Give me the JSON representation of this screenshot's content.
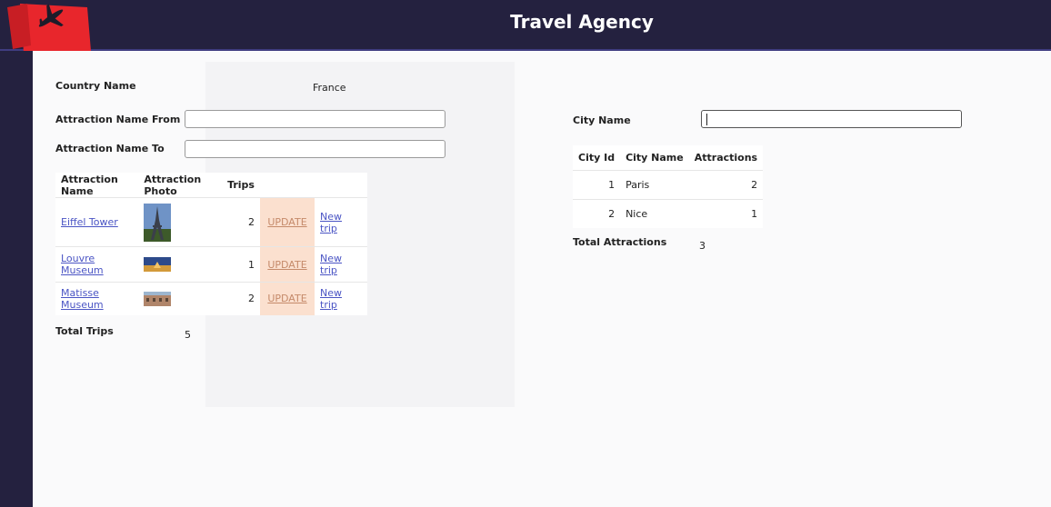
{
  "header": {
    "title": "Travel Agency",
    "logo_icon": "airplane-logo-icon",
    "brand_color": "#e8262c"
  },
  "filters": {
    "country_name_label": "Country Name",
    "country_name_value": "France",
    "attraction_from_label": "Attraction Name From",
    "attraction_from_value": "",
    "attraction_to_label": "Attraction Name To",
    "attraction_to_value": "",
    "city_name_label": "City Name",
    "city_name_value": ""
  },
  "attractions": {
    "columns": [
      "Attraction Name",
      "Attraction Photo",
      "Trips"
    ],
    "rows": [
      {
        "name": "Eiffel Tower",
        "photo": "eiffel-tower-photo",
        "trips": "2",
        "update": "UPDATE",
        "new_trip": "New trip"
      },
      {
        "name": "Louvre Museum",
        "photo": "louvre-museum-photo",
        "trips": "1",
        "update": "UPDATE",
        "new_trip": "New trip"
      },
      {
        "name": "Matisse Museum",
        "photo": "matisse-museum-photo",
        "trips": "2",
        "update": "UPDATE",
        "new_trip": "New trip"
      }
    ],
    "total_label": "Total Trips",
    "total_value": "5"
  },
  "cities": {
    "columns": [
      "City Id",
      "City Name",
      "Attractions"
    ],
    "rows": [
      {
        "id": "1",
        "name": "Paris",
        "attractions": "2"
      },
      {
        "id": "2",
        "name": "Nice",
        "attractions": "1"
      }
    ],
    "total_label": "Total Attractions",
    "total_value": "3"
  },
  "colors": {
    "header_bg": "#24213f",
    "link": "#4a54c4",
    "update_highlight": "#fbe0cf"
  }
}
